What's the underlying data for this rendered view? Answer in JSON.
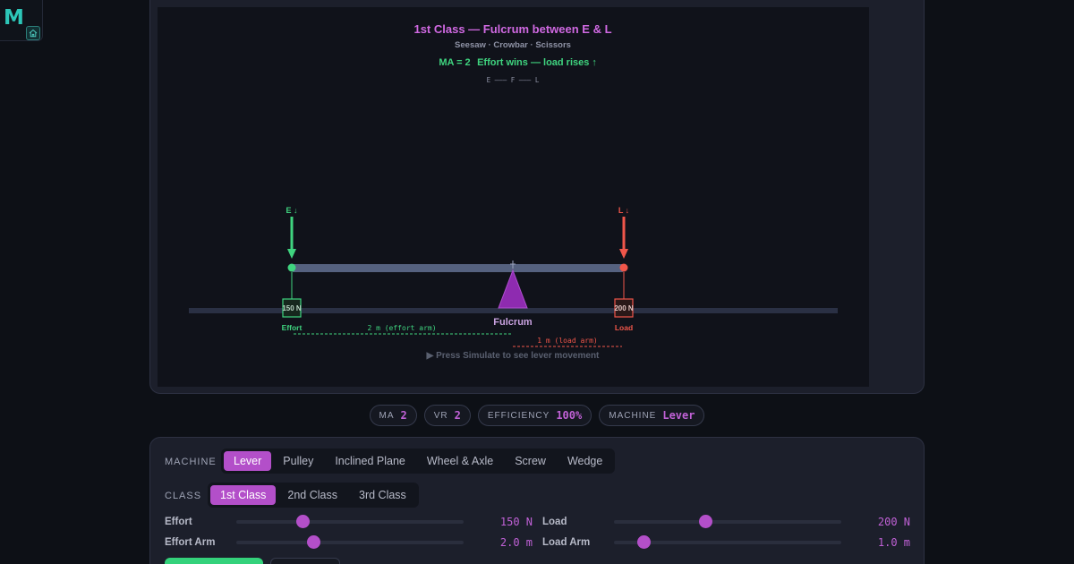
{
  "logo": {
    "letter": "M",
    "home_icon": "home-icon"
  },
  "diagram": {
    "title": "1st Class — Fulcrum between E & L",
    "subtitle": "Seesaw · Crowbar · Scissors",
    "ma_text": "MA = 2",
    "result_text": "Effort wins — load rises ↑",
    "order_text": "E ——— F ——— L",
    "effort_arrow_label": "E ↓",
    "load_arrow_label": "L ↓",
    "effort_box": "150 N",
    "load_box": "200 N",
    "effort_caption": "Effort",
    "load_caption": "Load",
    "fulcrum_caption": "Fulcrum",
    "effort_arm_label": "2 m (effort arm)",
    "load_arm_label": "1 m (load arm)",
    "hint": "▶ Press Simulate to see lever movement",
    "colors": {
      "effort": "#3fd47f",
      "load": "#f0564a",
      "fulcrum": "#8e2bb0",
      "title": "#d069e2"
    }
  },
  "stats": [
    {
      "key": "MA",
      "value": "2"
    },
    {
      "key": "VR",
      "value": "2"
    },
    {
      "key": "EFFICIENCY",
      "value": "100%"
    },
    {
      "key": "MACHINE",
      "value": "Lever"
    }
  ],
  "controls": {
    "machine_label": "MACHINE",
    "machines": [
      "Lever",
      "Pulley",
      "Inclined Plane",
      "Wheel & Axle",
      "Screw",
      "Wedge"
    ],
    "machine_selected": "Lever",
    "class_label": "CLASS",
    "classes": [
      "1st Class",
      "2nd Class",
      "3rd Class"
    ],
    "class_selected": "1st Class",
    "sliders": {
      "effort": {
        "label": "Effort",
        "value": "150 N",
        "level": 0.29
      },
      "effort_arm": {
        "label": "Effort Arm",
        "value": "2.0 m",
        "level": 0.34
      },
      "load": {
        "label": "Load",
        "value": "200 N",
        "level": 0.4
      },
      "load_arm": {
        "label": "Load Arm",
        "value": "1.0 m",
        "level": 0.13
      }
    }
  }
}
